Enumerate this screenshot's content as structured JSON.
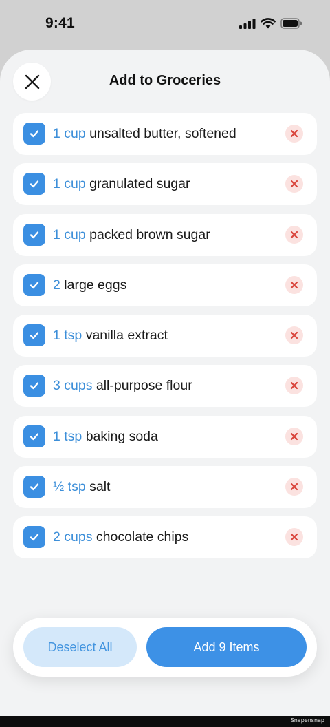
{
  "status": {
    "time": "9:41"
  },
  "sheet": {
    "title": "Add to Groceries"
  },
  "items": [
    {
      "qty": "1 cup",
      "name": "unsalted butter, softened",
      "checked": true
    },
    {
      "qty": "1 cup",
      "name": "granulated sugar",
      "checked": true
    },
    {
      "qty": "1 cup",
      "name": "packed brown sugar",
      "checked": true
    },
    {
      "qty": "2",
      "name": "large eggs",
      "checked": true
    },
    {
      "qty": "1 tsp",
      "name": "vanilla extract",
      "checked": true
    },
    {
      "qty": "3 cups",
      "name": "all-purpose flour",
      "checked": true
    },
    {
      "qty": "1 tsp",
      "name": "baking soda",
      "checked": true
    },
    {
      "qty": "½ tsp",
      "name": "salt",
      "checked": true
    },
    {
      "qty": "2 cups",
      "name": "chocolate chips",
      "checked": true
    }
  ],
  "actions": {
    "deselect_label": "Deselect All",
    "add_label": "Add 9 Items"
  },
  "watermark": "Snapensnap",
  "colors": {
    "accent": "#3d91e6",
    "quantity": "#3d8fd9",
    "remove_bg": "#fbe2e0",
    "remove_icon": "#d9453c",
    "deselect_bg": "#d4e8fa"
  },
  "icons": {
    "close": "close-icon",
    "check": "checkmark-icon",
    "remove": "remove-x-icon",
    "signal": "cellular-signal-icon",
    "wifi": "wifi-icon",
    "battery": "battery-icon"
  }
}
